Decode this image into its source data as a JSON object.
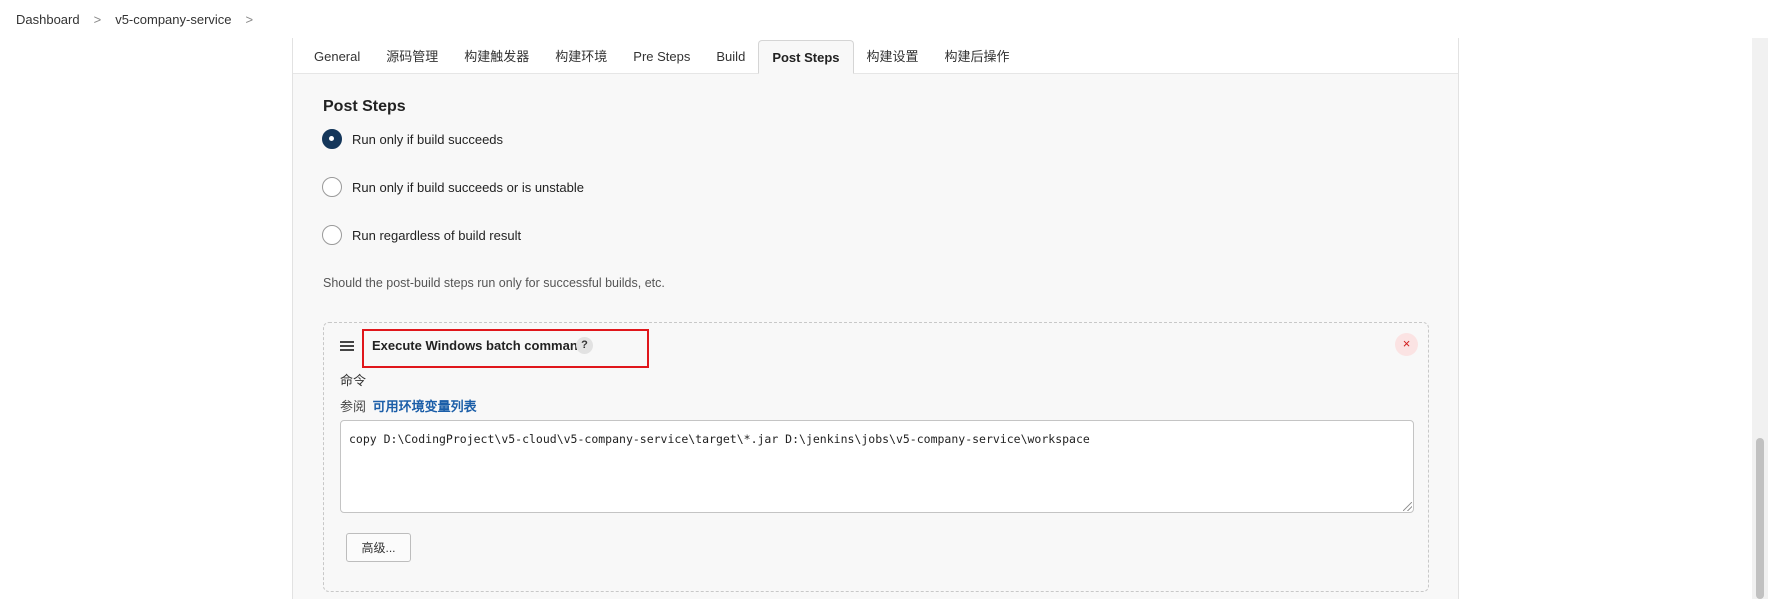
{
  "breadcrumb": {
    "items": [
      "Dashboard",
      "v5-company-service"
    ],
    "separator": ">"
  },
  "tabs": [
    {
      "label": "General"
    },
    {
      "label": "源码管理"
    },
    {
      "label": "构建触发器"
    },
    {
      "label": "构建环境"
    },
    {
      "label": "Pre Steps"
    },
    {
      "label": "Build"
    },
    {
      "label": "Post Steps",
      "active": true
    },
    {
      "label": "构建设置"
    },
    {
      "label": "构建后操作"
    }
  ],
  "post_steps": {
    "title": "Post Steps",
    "options": [
      {
        "label": "Run only if build succeeds",
        "checked": true
      },
      {
        "label": "Run only if build succeeds or is unstable",
        "checked": false
      },
      {
        "label": "Run regardless of build result",
        "checked": false
      }
    ],
    "help": "Should the post-build steps run only for successful builds, etc."
  },
  "step": {
    "title": "Execute Windows batch command",
    "help_label": "?",
    "close_label": "×",
    "command_label": "命令",
    "ref_prefix": "参阅",
    "ref_link": "可用环境变量列表",
    "command": "copy D:\\CodingProject\\v5-cloud\\v5-company-service\\target\\*.jar D:\\jenkins\\jobs\\v5-company-service\\workspace",
    "advanced_label": "高级..."
  },
  "colors": {
    "accent": "#14365a",
    "link": "#1b5ea8",
    "highlight": "#e0161b",
    "danger": "#d01c1c"
  }
}
